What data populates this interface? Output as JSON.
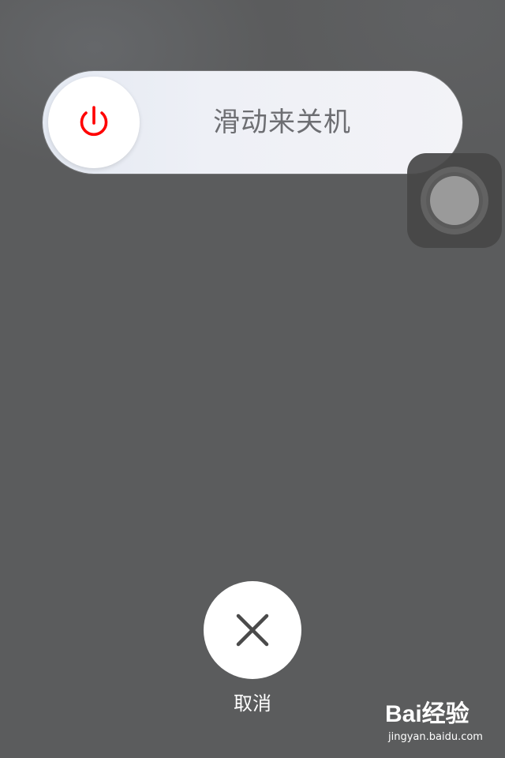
{
  "slider": {
    "label": "滑动来关机",
    "icon": "power-icon",
    "icon_color": "#ff0000"
  },
  "assistive_touch": {
    "icon": "assistive-touch-icon"
  },
  "cancel": {
    "label": "取消",
    "icon": "close-icon"
  },
  "watermark": {
    "logo": "Bai经验",
    "url": "jingyan.baidu.com"
  },
  "colors": {
    "background": "#5b5c5d",
    "slider_track": "#eef0f6",
    "power_red": "#ff0000",
    "label_gray": "#6d6e72"
  }
}
